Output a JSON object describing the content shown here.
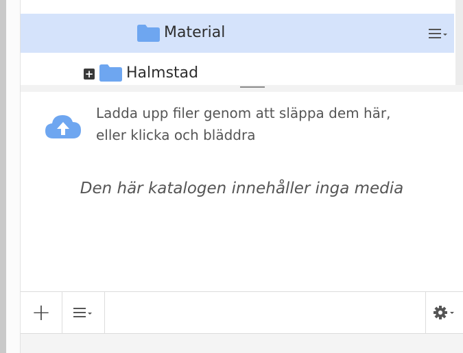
{
  "tree": {
    "items": [
      {
        "label": "Material",
        "icon": "folder-icon",
        "selected": true
      },
      {
        "label": "Halmstad",
        "icon": "folder-icon",
        "expand": "+"
      }
    ]
  },
  "upload": {
    "line1": "Ladda upp filer genom att släppa dem här,",
    "line2": "eller klicka och bläddra",
    "empty_message": "Den här katalogen innehåller inga media"
  },
  "toolbar": {
    "add_label": "+"
  },
  "colors": {
    "selected_row": "#d5e3fb",
    "folder": "#6ea6f0",
    "cloud": "#6ea6f0"
  }
}
